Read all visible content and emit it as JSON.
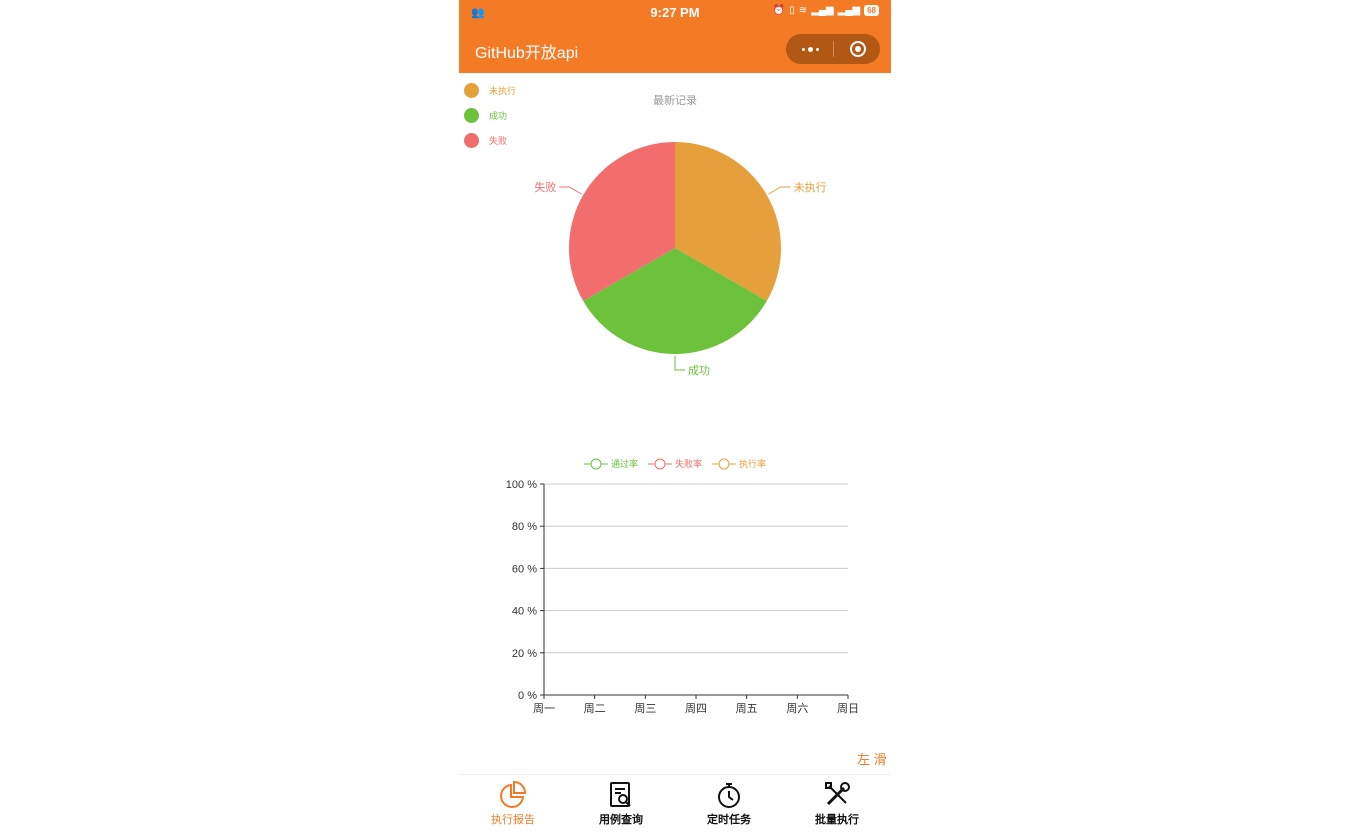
{
  "status_bar": {
    "time": "9:27 PM",
    "battery": "68"
  },
  "nav": {
    "title": "GitHub开放api"
  },
  "colors": {
    "accent": "#f47b25",
    "pending": "#e5a03c",
    "success": "#6cc23a",
    "fail": "#f26d6d"
  },
  "pie_chart": {
    "title": "最新记录",
    "legend": [
      {
        "label": "未执行",
        "color": "#e5a03c"
      },
      {
        "label": "成功",
        "color": "#6cc23a"
      },
      {
        "label": "失败",
        "color": "#f26d6d"
      }
    ]
  },
  "line_chart": {
    "legend": [
      {
        "label": "通过率",
        "color": "#6cc23a"
      },
      {
        "label": "失败率",
        "color": "#f26d6d"
      },
      {
        "label": "执行率",
        "color": "#e5a03c"
      }
    ]
  },
  "chart_data": [
    {
      "type": "pie",
      "title": "最新记录",
      "categories": [
        "未执行",
        "成功",
        "失败"
      ],
      "values": [
        1,
        1,
        1
      ],
      "colors": [
        "#e5a03c",
        "#6cc23a",
        "#f26d6d"
      ],
      "legend_position": "top-left"
    },
    {
      "type": "line",
      "categories": [
        "周一",
        "周二",
        "周三",
        "周四",
        "周五",
        "周六",
        "周日"
      ],
      "series": [
        {
          "name": "通过率",
          "values": []
        },
        {
          "name": "失败率",
          "values": []
        },
        {
          "name": "执行率",
          "values": []
        }
      ],
      "yticks": [
        "0 %",
        "20 %",
        "40 %",
        "60 %",
        "80 %",
        "100 %"
      ],
      "ylim": [
        0,
        100
      ],
      "grid": true,
      "legend_position": "top"
    }
  ],
  "swipe_hint": "左 滑",
  "tabbar": [
    {
      "label": "执行报告",
      "icon": "pie-chart-icon",
      "active": true
    },
    {
      "label": "用例查询",
      "icon": "document-search-icon",
      "active": false
    },
    {
      "label": "定时任务",
      "icon": "stopwatch-icon",
      "active": false
    },
    {
      "label": "批量执行",
      "icon": "tools-icon",
      "active": false
    }
  ]
}
